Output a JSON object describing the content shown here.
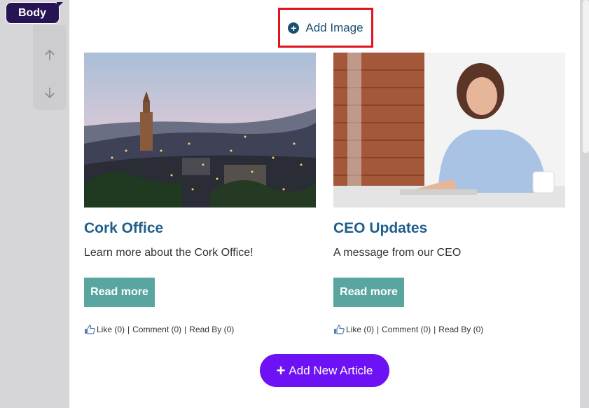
{
  "editor": {
    "element_label": "Body",
    "move_icon": "move-icon",
    "up_icon": "arrow-up-icon",
    "down_icon": "arrow-down-icon"
  },
  "add_image": {
    "label": "Add Image",
    "icon": "plus-circle-icon",
    "highlight_color": "#e0141e"
  },
  "cards": [
    {
      "title": "Cork Office",
      "description": "Learn more about the Cork Office!",
      "button": "Read more",
      "like": "Like (0)",
      "comment": "Comment (0)",
      "read_by": "Read By (0)",
      "image": "cork-city-dusk-photo"
    },
    {
      "title": "CEO Updates",
      "description": "A message from our CEO",
      "button": "Read more",
      "like": "Like (0)",
      "comment": "Comment (0)",
      "read_by": "Read By (0)",
      "image": "woman-at-laptop-photo"
    }
  ],
  "add_article": {
    "label": "Add New Article",
    "color": "#6d12f5"
  },
  "colors": {
    "title": "#1f5e8c",
    "button": "#59a6a1",
    "body_tag": "#271455"
  }
}
